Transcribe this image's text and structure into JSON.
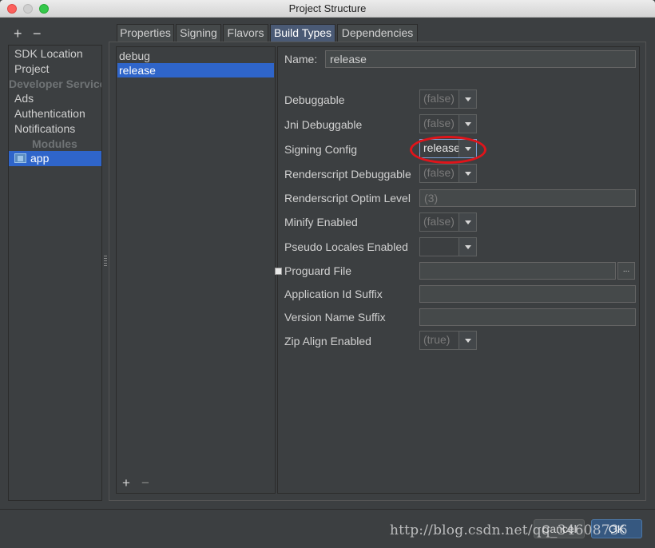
{
  "window": {
    "title": "Project Structure"
  },
  "toolbar": {
    "add_label": "+",
    "remove_label": "−"
  },
  "leftnav": {
    "items": [
      {
        "label": "SDK Location"
      },
      {
        "label": "Project"
      },
      {
        "label": "Developer Services"
      },
      {
        "label": "Ads"
      },
      {
        "label": "Authentication"
      },
      {
        "label": "Notifications"
      },
      {
        "label": "Modules"
      },
      {
        "label": "app"
      }
    ]
  },
  "tabs": [
    {
      "label": "Properties"
    },
    {
      "label": "Signing"
    },
    {
      "label": "Flavors"
    },
    {
      "label": "Build Types"
    },
    {
      "label": "Dependencies"
    }
  ],
  "build_types": {
    "items": [
      {
        "label": "debug"
      },
      {
        "label": "release"
      }
    ],
    "add_label": "+",
    "remove_label": "−"
  },
  "form": {
    "name_label": "Name:",
    "name_value": "release",
    "debuggable": {
      "label": "Debuggable",
      "value": "(false)"
    },
    "jni_debuggable": {
      "label": "Jni Debuggable",
      "value": "(false)"
    },
    "signing_config": {
      "label": "Signing Config",
      "value": "release"
    },
    "renderscript_debuggable": {
      "label": "Renderscript Debuggable",
      "value": "(false)"
    },
    "renderscript_optim": {
      "label": "Renderscript Optim Level",
      "value": "(3)"
    },
    "minify_enabled": {
      "label": "Minify Enabled",
      "value": "(false)"
    },
    "pseudo_locales": {
      "label": "Pseudo Locales Enabled",
      "value": ""
    },
    "proguard_file": {
      "label": "Proguard File",
      "value": "",
      "browse_label": "..."
    },
    "app_id_suffix": {
      "label": "Application Id Suffix",
      "value": ""
    },
    "version_name_suffix": {
      "label": "Version Name Suffix",
      "value": ""
    },
    "zip_align": {
      "label": "Zip Align Enabled",
      "value": "(true)"
    }
  },
  "buttons": {
    "cancel_label": "Cancel",
    "ok_label": "OK"
  },
  "watermark": "http://blog.csdn.net/qq_34608736",
  "colors": {
    "accent": "#2f65ca",
    "background": "#3c3f41",
    "highlight_ring": "#e0141a"
  }
}
